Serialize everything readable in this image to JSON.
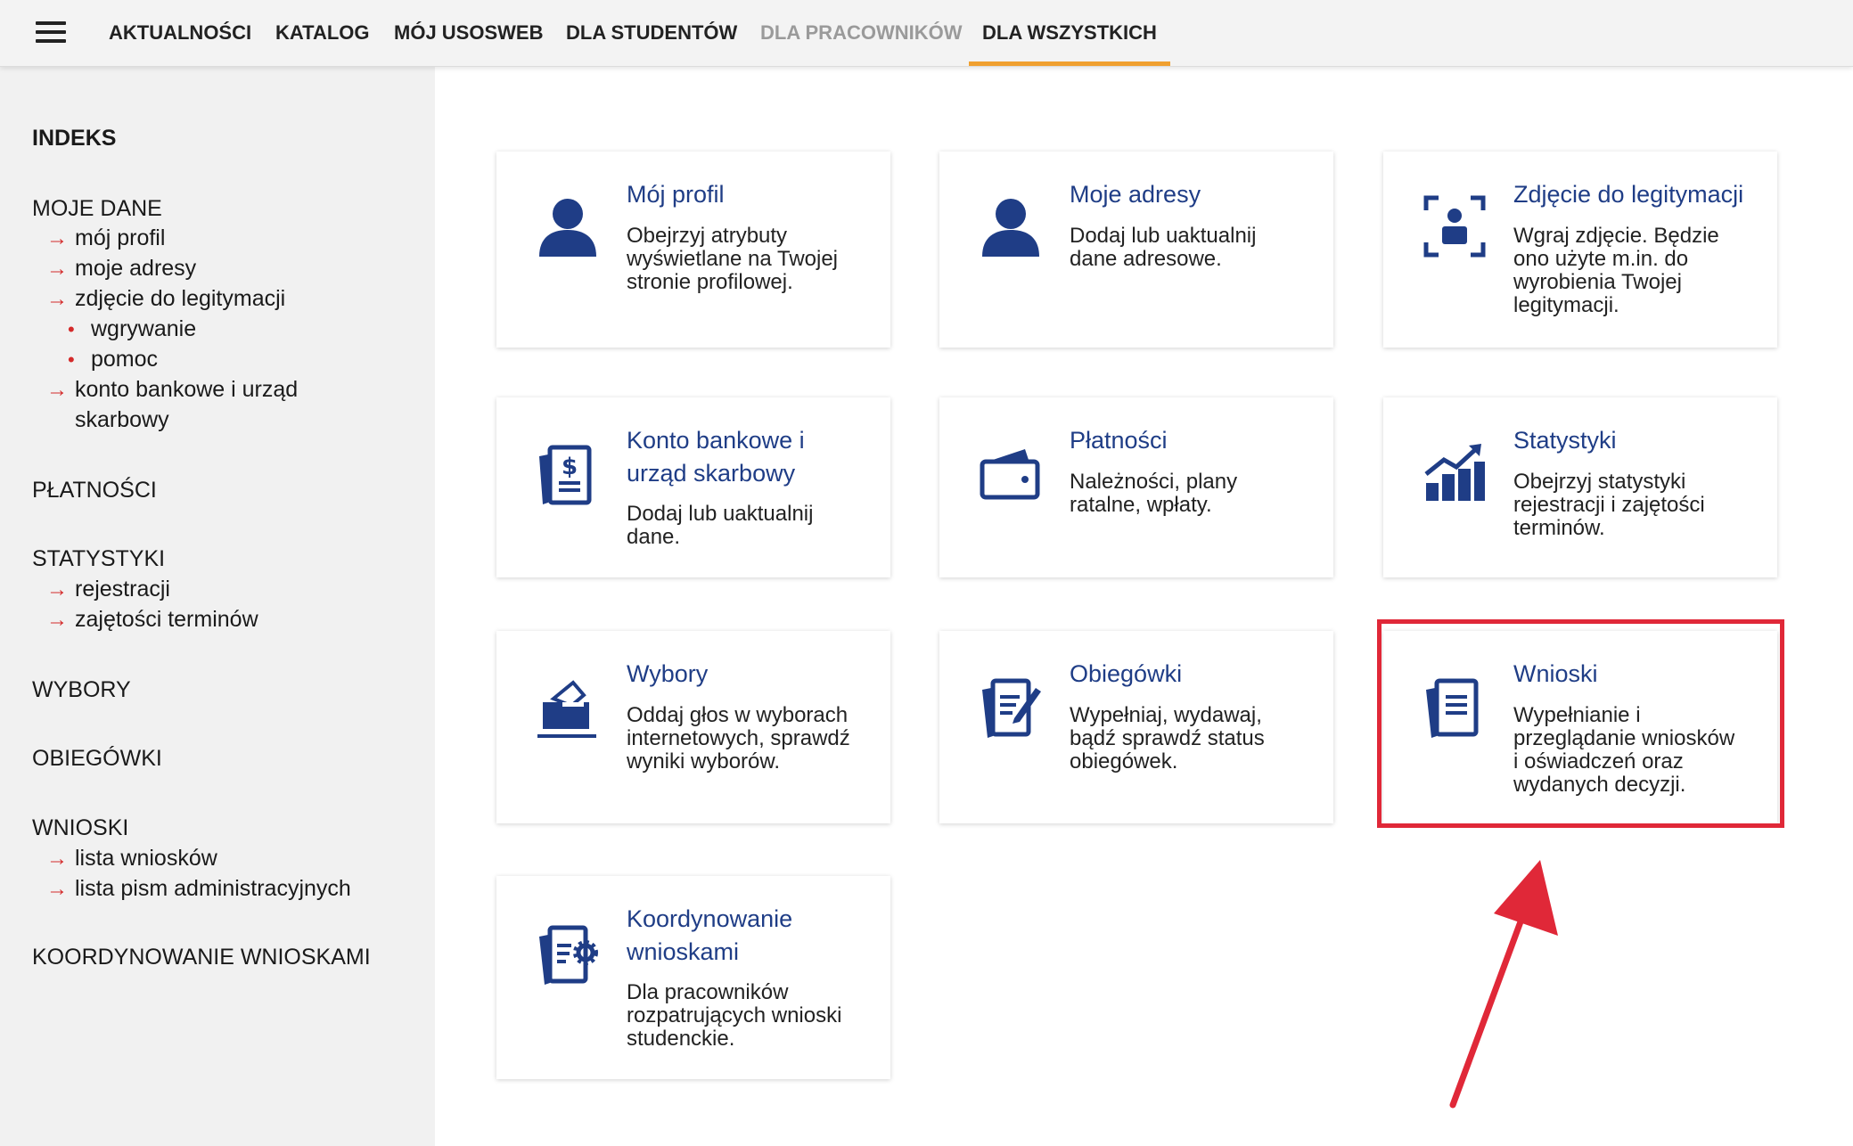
{
  "nav": {
    "items": [
      {
        "label": "AKTUALNOŚCI"
      },
      {
        "label": "KATALOG"
      },
      {
        "label": "MÓJ USOSWEB"
      },
      {
        "label": "DLA STUDENTÓW"
      },
      {
        "label": "DLA PRACOWNIKÓW"
      },
      {
        "label": "DLA WSZYSTKICH"
      }
    ],
    "active": "DLA WSZYSTKICH",
    "accent_color": "#f0a030"
  },
  "sidebar": {
    "indeks": "INDEKS",
    "moje_dane": {
      "label": "MOJE DANE",
      "items": [
        "mój profil",
        "moje adresy",
        "zdjęcie do legitymacji"
      ],
      "sub_items": [
        "wgrywanie",
        "pomoc"
      ],
      "konto": [
        "konto bankowe i urząd",
        "skarbowy"
      ]
    },
    "platnosci": "PŁATNOŚCI",
    "statystyki": {
      "label": "STATYSTYKI",
      "items": [
        "rejestracji",
        "zajętości terminów"
      ]
    },
    "wybory": "WYBORY",
    "obiegowki": "OBIEGÓWKI",
    "wnioski": {
      "label": "WNIOSKI",
      "items": [
        "lista wniosków",
        "lista pism administracyjnych"
      ]
    },
    "koordynowanie": "KOORDYNOWANIE WNIOSKAMI"
  },
  "tiles": {
    "profil": {
      "icon": "user-icon",
      "title": [
        "Mój profil"
      ],
      "desc": [
        "Obejrzyj atrybuty",
        "wyświetlane na Twojej",
        "stronie profilowej."
      ]
    },
    "adresy": {
      "icon": "user-icon",
      "title": [
        "Moje adresy"
      ],
      "desc": [
        "Dodaj lub uaktualnij",
        "dane adresowe."
      ]
    },
    "zdjecie": {
      "icon": "photo-frame-icon",
      "title": [
        "Zdjęcie do legitymacji"
      ],
      "desc": [
        "Wgraj zdjęcie. Będzie",
        "ono użyte m.in. do",
        "wyrobienia Twojej",
        "legitymacji."
      ]
    },
    "konto": {
      "icon": "bank-document-icon",
      "title": [
        "Konto bankowe i",
        "urząd skarbowy"
      ],
      "desc": [
        "Dodaj lub uaktualnij",
        "dane."
      ]
    },
    "platnosci": {
      "icon": "wallet-icon",
      "title": [
        "Płatności"
      ],
      "desc": [
        "Należności, plany",
        "ratalne, wpłaty."
      ]
    },
    "statystyki": {
      "icon": "bar-chart-icon",
      "title": [
        "Statystyki"
      ],
      "desc": [
        "Obejrzyj statystyki",
        "rejestracji i zajętości",
        "terminów."
      ]
    },
    "wybory": {
      "icon": "ballot-box-icon",
      "title": [
        "Wybory"
      ],
      "desc": [
        "Oddaj głos w wyborach",
        "internetowych, sprawdź",
        "wyniki wyborów."
      ]
    },
    "obiegowki": {
      "icon": "edit-document-icon",
      "title": [
        "Obiegówki"
      ],
      "desc": [
        "Wypełniaj, wydawaj,",
        "bądź sprawdź status",
        "obiegówek."
      ]
    },
    "wnioski": {
      "icon": "document-icon",
      "title": [
        "Wnioski"
      ],
      "desc": [
        "Wypełnianie i",
        "przeglądanie wniosków",
        "i oświadczeń oraz",
        "wydanych decyzji."
      ]
    },
    "koordynowanie": {
      "icon": "document-gear-icon",
      "title": [
        "Koordynowanie",
        "wnioskami"
      ],
      "desc": [
        "Dla pracowników",
        "rozpatrujących wnioski",
        "studenckie."
      ]
    }
  },
  "colors": {
    "tile_title": "#1f3d86",
    "icon": "#1f3d86",
    "sidebar_arrow": "#d42a2a",
    "annotation": "#e02838"
  }
}
